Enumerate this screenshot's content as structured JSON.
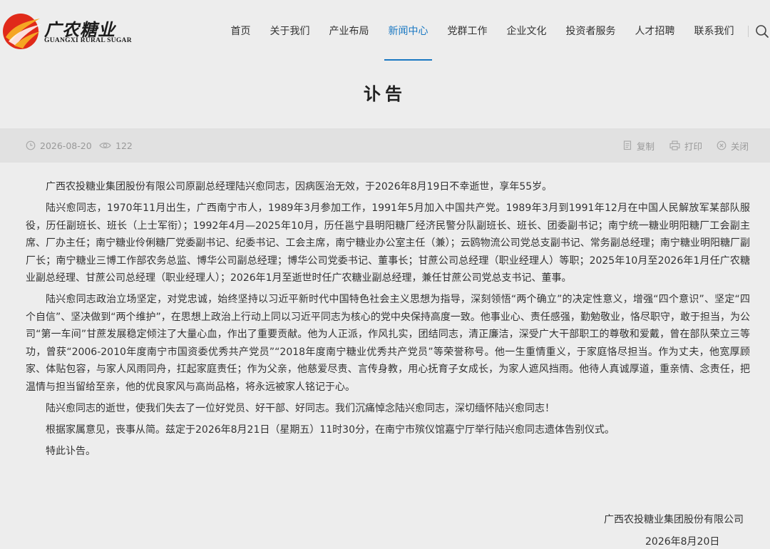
{
  "brand": {
    "name_cn": "广农糖业",
    "name_en": "GUANGXI RURAL SUGAR",
    "colors": {
      "red": "#e02a1a",
      "orange": "#f5a623",
      "accent": "#1a78c2"
    }
  },
  "nav": {
    "items": [
      {
        "label": "首页"
      },
      {
        "label": "关于我们"
      },
      {
        "label": "产业布局"
      },
      {
        "label": "新闻中心",
        "active": true
      },
      {
        "label": "党群工作"
      },
      {
        "label": "企业文化"
      },
      {
        "label": "投资者服务"
      },
      {
        "label": "人才招聘"
      },
      {
        "label": "联系我们"
      }
    ],
    "search_icon": "search-icon"
  },
  "article": {
    "title": "讣告",
    "date": "2026-08-20",
    "views": "122",
    "actions": {
      "copy": "复制",
      "print": "打印",
      "close": "关闭"
    },
    "paragraphs": [
      "广西农投糖业集团股份有限公司原副总经理陆兴愈同志，因病医治无效，于2026年8月19日不幸逝世，享年55岁。",
      "陆兴愈同志，1970年11月出生，广西南宁市人，1989年3月参加工作，1991年5月加入中国共产党。1989年3月到1991年12月在中国人民解放军某部队服役，历任副班长、班长（上士军衔）；1992年4月—2025年10月，历任邕宁县明阳糖厂经济民警分队副班长、班长、团委副书记；南宁统一糖业明阳糖厂工会副主席、厂办主任；南宁糖业伶俐糖厂党委副书记、纪委书记、工会主席，南宁糖业办公室主任（兼）；云鸥物流公司党总支副书记、常务副总经理；南宁糖业明阳糖厂副厂长；南宁糖业三博工作部农务总监、博华公司副总经理；博华公司党委书记、董事长；甘蔗公司总经理（职业经理人）等职；2025年10月至2026年1月任广农糖业副总经理、甘蔗公司总经理（职业经理人）；2026年1月至逝世时任广农糖业副总经理，兼任甘蔗公司党总支书记、董事。",
      "陆兴愈同志政治立场坚定，对党忠诚，始终坚持以习近平新时代中国特色社会主义思想为指导，深刻领悟“两个确立”的决定性意义，增强“四个意识”、坚定“四个自信”、坚决做到“两个维护”，在思想上政治上行动上同以习近平同志为核心的党中央保持高度一致。他事业心、责任感强，勤勉敬业，恪尽职守，敢于担当，为公司“第一车间”甘蔗发展稳定倾注了大量心血，作出了重要贡献。他为人正派，作风扎实，团结同志，清正廉洁，深受广大干部职工的尊敬和爱戴，曾在部队荣立三等功，曾获“2006-2010年度南宁市国资委优秀共产党员”“2018年度南宁糖业优秀共产党员”等荣誉称号。他一生重情重义，于家庭恪尽担当。作为丈夫，他宽厚顾家、体贴包容，与家人风雨同舟，扛起家庭责任；作为父亲，他慈爱尽责、言传身教，用心抚育子女成长，为家人遮风挡雨。他待人真诚厚道，重亲情、念责任，把温情与担当留给至亲，他的优良家风与高尚品格，将永远被家人铭记于心。",
      "陆兴愈同志的逝世，使我们失去了一位好党员、好干部、好同志。我们沉痛悼念陆兴愈同志，深切缅怀陆兴愈同志！",
      "根据家属意见，丧事从简。兹定于2026年8月21日（星期五）11时30分，在南宁市殡仪馆嘉宁厅举行陆兴愈同志遗体告别仪式。",
      "特此讣告。"
    ],
    "signature": {
      "company": "广西农投糖业集团股份有限公司",
      "date": "2026年8月20日"
    }
  }
}
